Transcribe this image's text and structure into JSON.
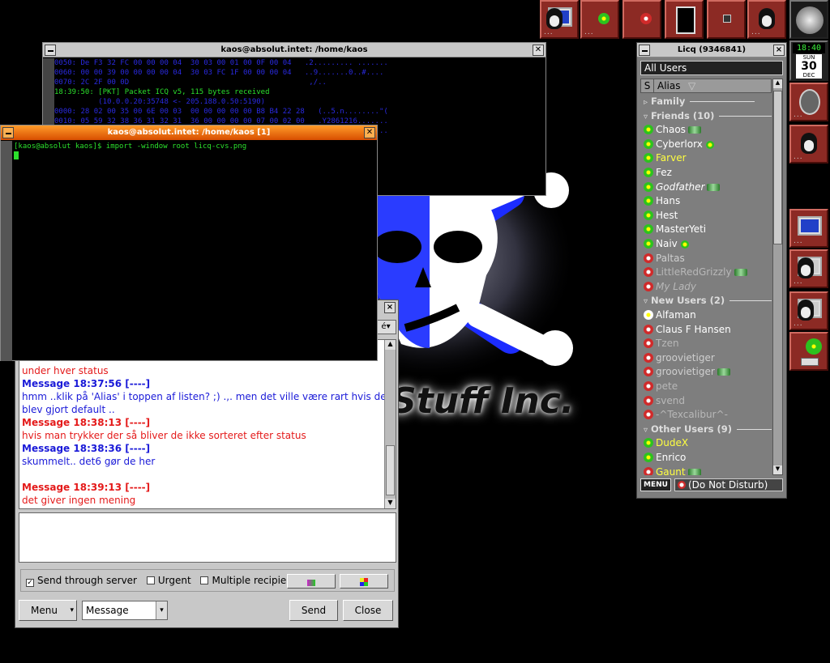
{
  "clock": {
    "time": "18:40",
    "day_name": "SUN",
    "day": "30",
    "month": "DEC"
  },
  "back_terminal": {
    "title": "kaos@absolut.intet: /home/kaos",
    "lines": [
      "0050: De F3 32 FC 00 00 00 04  30 03 00 01 00 0F 00 04   .2......... .......",
      "0060: 00 00 39 00 00 00 00 04  30 03 FC 1F 00 00 00 04   ..9.......0..#....",
      "0070: 2C 2F 00 0D                                         ,/..",
      "18:39:50: [PKT] Packet ICQ v5, 115 bytes received",
      "          (10.0.0.20:35748 <- 205.188.0.50:5190)",
      "0000: 28 02 00 35 00 6E 00 03  00 00 00 00 00 B8 B4 22 28   (..5.n........\"(",
      "0010: 05 59 32 38 36 31 32 31  36 00 00 00 00 07 00 02 00   .Y2861216.......",
      "0020: 00 00 00 00 00 00 00 00  00 00 00 00 00 00 00 00 00   ................"
    ]
  },
  "front_terminal": {
    "title": "kaos@absolut.intet: /home/kaos  [1]",
    "prompt": "[kaos@absolut kaos]$ import -window root licq-cvs.png"
  },
  "wallpaper": {
    "brand": "Stuff Inc."
  },
  "chat": {
    "lines": [
      {
        "text": "under hver status",
        "type": "red"
      },
      {
        "text": "Message 18:37:56 [----]",
        "type": "blue-head"
      },
      {
        "text": "hmm ..klik på 'Alias' i toppen af listen? ;) .,. men det ville være rart hvis det",
        "type": "blue"
      },
      {
        "text": "blev gjort default ..",
        "type": "blue"
      },
      {
        "text": "Message 18:38:13 [----]",
        "type": "red-head"
      },
      {
        "text": "hvis man trykker der så bliver de ikke sorteret efter status",
        "type": "red"
      },
      {
        "text": "Message 18:38:36 [----]",
        "type": "blue-head"
      },
      {
        "text": "skummelt.. det6 gør de her",
        "type": "blue"
      },
      {
        "text": "",
        "type": "blank"
      },
      {
        "text": "Message 18:39:13 [----]",
        "type": "red-head"
      },
      {
        "text": "det giver ingen mening",
        "type": "red"
      }
    ],
    "send_through_server": "Send through server",
    "urgent": "Urgent",
    "multiple_recipients": "Multiple recipients",
    "menu_label": "Menu",
    "type_select": "Message",
    "send_label": "Send",
    "close_label": "Close",
    "mini_select": "é",
    "close_x": "×"
  },
  "licq": {
    "title": "Licq (9346841)",
    "all_users": "All Users",
    "col_s": "S",
    "col_alias": "Alias",
    "menu_label": "MENU",
    "status": "(Do Not Disturb)",
    "close_x": "×",
    "rows": [
      {
        "kind": "group-closed",
        "text": "Family"
      },
      {
        "kind": "group",
        "text": "Friends (10)"
      },
      {
        "kind": "user",
        "text": "Chaos",
        "icon": "g",
        "color": "#ffffff",
        "chip": true
      },
      {
        "kind": "user",
        "text": "Cyberlorx",
        "icon": "g",
        "color": "#ffffff",
        "flower2": true
      },
      {
        "kind": "user",
        "text": "Farver",
        "icon": "g",
        "color": "#ffff40"
      },
      {
        "kind": "user",
        "text": "Fez",
        "icon": "g",
        "color": "#ffffff"
      },
      {
        "kind": "user",
        "text": "Godfather",
        "icon": "g",
        "color": "#ffffff",
        "italic": true,
        "chip": true
      },
      {
        "kind": "user",
        "text": "Hans",
        "icon": "g",
        "color": "#ffffff"
      },
      {
        "kind": "user",
        "text": "Hest",
        "icon": "g",
        "color": "#ffffff"
      },
      {
        "kind": "user",
        "text": "MasterYeti",
        "icon": "g",
        "color": "#ffffff"
      },
      {
        "kind": "user",
        "text": "Naiv",
        "icon": "g",
        "color": "#ffffff",
        "flower2": true
      },
      {
        "kind": "user",
        "text": "Paltas",
        "icon": "r",
        "color": "#cfcfcf"
      },
      {
        "kind": "user",
        "text": "LittleRedGrizzly",
        "icon": "r",
        "color": "#b8b8b8",
        "chip": true
      },
      {
        "kind": "user",
        "text": "My Lady",
        "icon": "r",
        "color": "#b8b8b8",
        "italic": true
      },
      {
        "kind": "group",
        "text": "New Users (2)"
      },
      {
        "kind": "user",
        "text": "Alfaman",
        "icon": "w",
        "color": "#ffffff"
      },
      {
        "kind": "user",
        "text": "Claus F Hansen",
        "icon": "r",
        "color": "#ffffff"
      },
      {
        "kind": "user",
        "text": "Tzen",
        "icon": "r",
        "color": "#b8b8b8"
      },
      {
        "kind": "user",
        "text": "groovietiger",
        "icon": "r",
        "color": "#cfcfcf"
      },
      {
        "kind": "user",
        "text": "groovietiger",
        "icon": "r",
        "color": "#cfcfcf",
        "chip": true
      },
      {
        "kind": "user",
        "text": "pete",
        "icon": "r",
        "color": "#b8b8b8"
      },
      {
        "kind": "user",
        "text": "svend",
        "icon": "r",
        "color": "#b8b8b8"
      },
      {
        "kind": "user",
        "text": "-^Texcalibur^-",
        "icon": "r",
        "color": "#b8b8b8"
      },
      {
        "kind": "group",
        "text": "Other Users (9)"
      },
      {
        "kind": "user",
        "text": "DudeX",
        "icon": "g",
        "color": "#ffff40"
      },
      {
        "kind": "user",
        "text": "Enrico",
        "icon": "g",
        "color": "#ffffff"
      },
      {
        "kind": "user",
        "text": "Gaunt",
        "icon": "r",
        "color": "#ffff40",
        "chip": true
      }
    ]
  },
  "colors": {
    "dock": "#8c2a24",
    "licq_bg": "#7e7e7e",
    "terminal_text": "#2a2ae0",
    "prompt": "#2ce02c"
  }
}
